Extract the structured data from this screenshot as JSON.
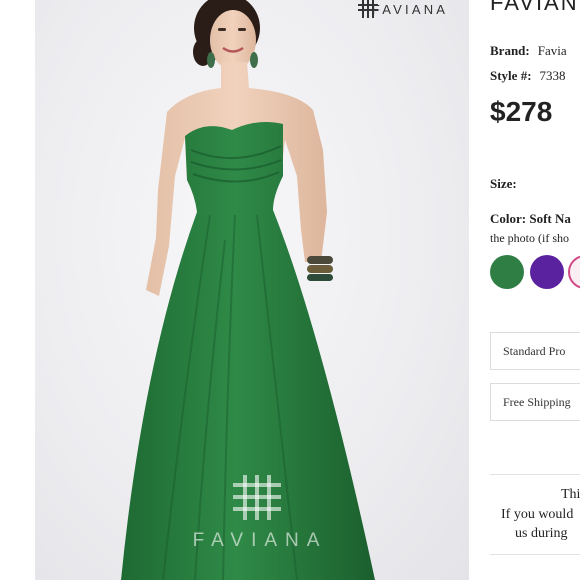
{
  "product": {
    "title": "FAVIAN",
    "brand_label": "Brand:",
    "brand_value": "Favia",
    "style_label": "Style #:",
    "style_value": "7338",
    "price": "$278",
    "size_label": "Size:",
    "color_label": "Color: Soft Na",
    "color_note": "the photo (if sho",
    "swatches": [
      {
        "name": "green",
        "color": "#2f7f45"
      },
      {
        "name": "purple",
        "color": "#5b229f"
      },
      {
        "name": "pink-outline",
        "color": "#cf4a84"
      }
    ],
    "options": [
      "Standard Pro",
      "Free Shipping"
    ],
    "notice": [
      "Thi",
      "If you would",
      "us during"
    ]
  },
  "photo": {
    "logo_word": "FAVIANA",
    "watermark_word": "FAVIANA",
    "dress_color": "#2a7a3e"
  }
}
